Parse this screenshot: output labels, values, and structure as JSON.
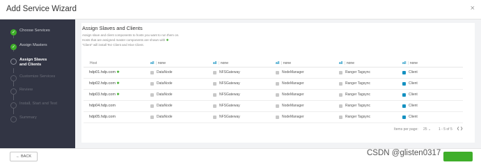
{
  "modal": {
    "title": "Add Service Wizard",
    "close": "×"
  },
  "sidebar": {
    "steps": [
      {
        "label": "Choose Services",
        "status": "done",
        "mark": "✓"
      },
      {
        "label": "Assign Masters",
        "status": "done",
        "mark": "✓"
      },
      {
        "label": "Assign Slaves and Clients",
        "status": "active",
        "mark": ""
      },
      {
        "label": "Customize Services",
        "status": "todo",
        "mark": ""
      },
      {
        "label": "Review",
        "status": "todo",
        "mark": ""
      },
      {
        "label": "Install, Start and Test",
        "status": "todo",
        "mark": ""
      },
      {
        "label": "Summary",
        "status": "todo",
        "mark": ""
      }
    ]
  },
  "main": {
    "title": "Assign Slaves and Clients",
    "desc1": "Assign slave and client components to hosts you want to run them on.",
    "desc2": "Hosts that are assigned master components are shown with",
    "desc2_star": "✱",
    "desc3": "\"Client\" will install Tez Client and Hive Client."
  },
  "table": {
    "host_header": "Host",
    "all": "all",
    "sep": "|",
    "none": "none",
    "columns": [
      "DataNode",
      "NFSGateway",
      "NodeManager",
      "Ranger Tagsync",
      "Client"
    ],
    "rows": [
      {
        "host": "hdp01.hdp.com",
        "master": "✱",
        "cells": [
          "DataNode",
          "NFSGateway",
          "NodeManager",
          "Ranger Tagsync",
          "Client"
        ]
      },
      {
        "host": "hdp02.hdp.com",
        "master": "✱",
        "cells": [
          "DataNode",
          "NFSGateway",
          "NodeManager",
          "Ranger Tagsync",
          "Client"
        ]
      },
      {
        "host": "hdp03.hdp.com",
        "master": "✱",
        "cells": [
          "DataNode",
          "NFSGateway",
          "NodeManager",
          "Ranger Tagsync",
          "Client"
        ]
      },
      {
        "host": "hdp04.hdp.com",
        "master": "",
        "cells": [
          "DataNode",
          "NFSGateway",
          "NodeManager",
          "Ranger Tagsync",
          "Client"
        ]
      },
      {
        "host": "hdp05.hdp.com",
        "master": "",
        "cells": [
          "DataNode",
          "NFSGateway",
          "NodeManager",
          "Ranger Tagsync",
          "Client"
        ]
      }
    ],
    "checked_column": 4
  },
  "pagination": {
    "label": "Items per page:",
    "per_page": "25",
    "caret": "⌄",
    "range": "1 - 5 of 5",
    "prev": "❮",
    "next": "❯"
  },
  "footer": {
    "back_label": "← BACK",
    "watermark": "CSDN @glisten0317"
  },
  "colors": {
    "accent": "#1491c1",
    "success": "#3fae2a",
    "sidebar": "#323544"
  }
}
